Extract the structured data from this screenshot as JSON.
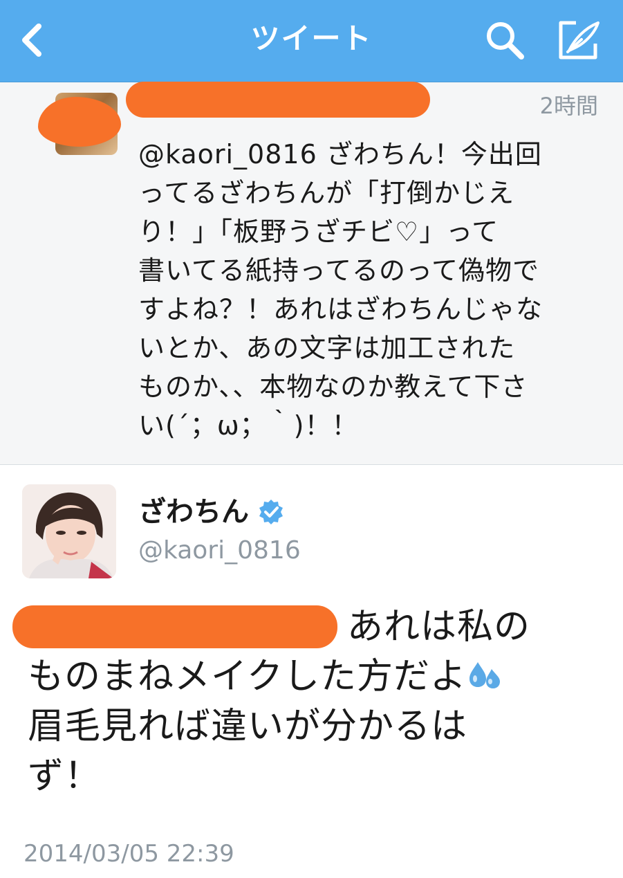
{
  "navbar": {
    "title": "ツイート",
    "background_color": "#55acee",
    "back_icon": "chevron-left-icon",
    "search_icon": "search-icon",
    "compose_icon": "compose-icon"
  },
  "reply_tweet": {
    "time_ago": "2時間",
    "text": "@kaori_0816 ざわちん！今出回\nってるざわちんが「打倒かじえ\nり！」「板野うざチビ♡」って\n書いてる紙持ってるのって偽物で\nすよね？！あれはざわちんじゃな\nいとか、あの文字は加工された\nものか、、本物なのか教えて下さ\nい(´；ω；｀)！！"
  },
  "main_tweet": {
    "display_name": "ざわちん",
    "verified": true,
    "screen_name": "@kaori_0816",
    "text_lines": [
      "あれは私の",
      "ものまねメイクした方だよ",
      "眉毛見れば違いが分かるは",
      "ず！"
    ],
    "sweat_emoji_icon": "sweat-drops-icon",
    "timestamp": "2014/03/05 22:39"
  },
  "colors": {
    "accent": "#55acee",
    "redaction": "#f77129",
    "muted_text": "#8e98a1",
    "verified_badge": "#55acee"
  }
}
